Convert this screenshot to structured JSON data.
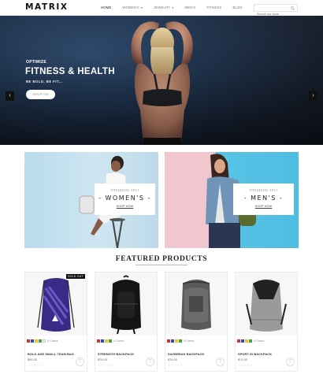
{
  "header": {
    "logo": "MATRIX",
    "nav": [
      {
        "label": "HOME",
        "caret": false,
        "active": true
      },
      {
        "label": "WOMEN'S",
        "caret": true,
        "active": false
      },
      {
        "label": "JEWELRY",
        "caret": true,
        "active": false
      },
      {
        "label": "MEN'S",
        "caret": false,
        "active": false
      },
      {
        "label": "FITNESS",
        "caret": false,
        "active": false
      },
      {
        "label": "BLOG",
        "caret": false,
        "active": false
      }
    ],
    "search_placeholder": "Search our store"
  },
  "hero": {
    "kicker": "OPTIMIZE",
    "title": "FITNESS & HEALTH",
    "subtitle": "BE BOLD, BE FIT...",
    "button": "SHOP ON",
    "prev_glyph": "‹",
    "next_glyph": "›",
    "slide_count": 3,
    "active_slide": 1
  },
  "banners": {
    "women": {
      "kicker": "TRENDING 2017",
      "title": "- WOMEN'S -",
      "link": "SHOP NOW"
    },
    "men": {
      "kicker": "TRENDING 2017",
      "title": "- MEN'S -",
      "link": "SHOP NOW"
    }
  },
  "featured": {
    "title": "FEATURED PRODUCTS",
    "products": [
      {
        "name": "BOLD AGE SMALL TEAM BAG",
        "price": "$90.00",
        "colors_label": "5 Colors",
        "badge": "SOLD OUT",
        "swatches": [
          "#d63030",
          "#1f4fd1",
          "#f0c419",
          "#3aaa3a",
          "#ededed"
        ],
        "stars": "☆☆☆☆☆",
        "cart_icon": "shopping-bag-icon"
      },
      {
        "name": "STRENGTH BACKPACK",
        "price": "$78.00",
        "colors_label": "4 Colors",
        "badge": "",
        "swatches": [
          "#d63030",
          "#1f4fd1",
          "#f0c419",
          "#3aaa3a"
        ],
        "stars": "☆☆☆☆☆",
        "cart_icon": "shopping-bag-icon"
      },
      {
        "name": "DAYBREAK BACKPACK",
        "price": "$76.00",
        "colors_label": "4 Colors",
        "badge": "",
        "swatches": [
          "#d63030",
          "#1f4fd1",
          "#f0c419",
          "#3aaa3a"
        ],
        "stars": "☆☆☆☆☆",
        "cart_icon": "shopping-bag-icon"
      },
      {
        "name": "SPORT ID BACKPACK",
        "price": "$79.00",
        "colors_label": "4 Colors",
        "badge": "",
        "swatches": [
          "#d63030",
          "#1f4fd1",
          "#f0c419",
          "#3aaa3a"
        ],
        "stars": "☆☆☆☆☆",
        "cart_icon": "shopping-bag-icon"
      }
    ]
  }
}
